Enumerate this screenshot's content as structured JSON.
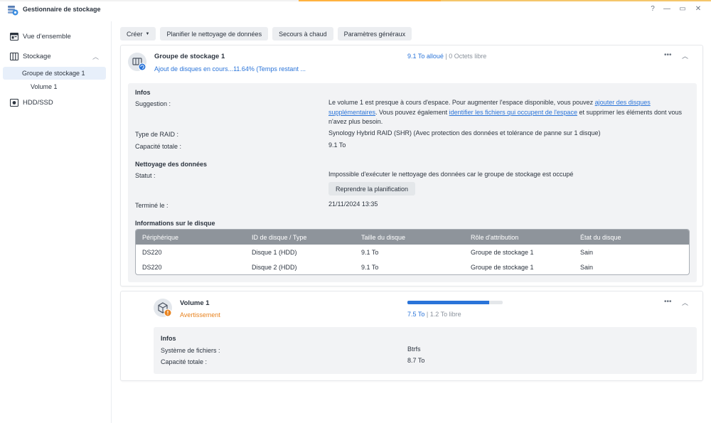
{
  "app": {
    "title": "Gestionnaire de stockage"
  },
  "window_controls": {
    "help": "?",
    "minimize": "—",
    "maximize": "▭",
    "close": "✕"
  },
  "sidebar": {
    "items": [
      {
        "label": "Vue d’ensemble",
        "icon": "overview-icon"
      },
      {
        "label": "Stockage",
        "icon": "storage-icon",
        "expanded": true
      },
      {
        "label": "Groupe de stockage 1",
        "selected": true
      },
      {
        "label": "Volume 1"
      },
      {
        "label": "HDD/SSD",
        "icon": "hdd-icon"
      }
    ]
  },
  "toolbar": {
    "create": "Créer",
    "schedule_scrub": "Planifier le nettoyage de données",
    "hot_spare": "Secours à chaud",
    "global_settings": "Paramètres généraux"
  },
  "pool": {
    "name": "Groupe de stockage 1",
    "status": "Ajout de disques en cours...11.64% (Temps restant ...",
    "allocated": "9.1 To alloué",
    "separator": "|",
    "free": "0 Octets libre",
    "info_title": "Infos",
    "suggestion_label": "Suggestion :",
    "suggestion_text_1": "Le volume 1 est presque à cours d'espace. Pour augmenter l'espace disponible, vous pouvez ",
    "suggestion_link_1": "ajouter des disques supplémentaires",
    "suggestion_text_2": ". Vous pouvez également ",
    "suggestion_link_2": "identifier les fichiers qui occupent de l'espace",
    "suggestion_text_3": " et supprimer les éléments dont vous n'avez plus besoin.",
    "raid_label": "Type de RAID :",
    "raid_value": "Synology Hybrid RAID (SHR) (Avec protection des données et tolérance de panne sur 1 disque)",
    "capacity_label": "Capacité totale :",
    "capacity_value": "9.1 To",
    "scrub_title": "Nettoyage des données",
    "status_label": "Statut :",
    "status_value": "Impossible d'exécuter le nettoyage des données car le groupe de stockage est occupé",
    "resume_button": "Reprendre la planification",
    "finished_label": "Terminé le :",
    "finished_value": "21/11/2024 13:35",
    "disk_info_title": "Informations sur le disque",
    "table": {
      "headers": [
        "Périphérique",
        "ID de disque / Type",
        "Taille du disque",
        "Rôle d'attribution",
        "État du disque"
      ],
      "rows": [
        [
          "DS220",
          "Disque 1 (HDD)",
          "9.1 To",
          "Groupe de stockage 1",
          "Sain"
        ],
        [
          "DS220",
          "Disque 2 (HDD)",
          "9.1 To",
          "Groupe de stockage 1",
          "Sain"
        ]
      ]
    }
  },
  "volume": {
    "name": "Volume 1",
    "status": "Avertissement",
    "used": "7.5 To",
    "separator": "|",
    "free": "1.2 To libre",
    "usage_fraction": 0.86,
    "info_title": "Infos",
    "fs_label": "Système de fichiers :",
    "fs_value": "Btrfs",
    "capacity_label": "Capacité totale :",
    "capacity_value": "8.7 To"
  },
  "colors": {
    "accent": "#2a74d9",
    "warning": "#e8831f",
    "healthy": "#2c9c2c",
    "selected_nav": "#e7effa"
  }
}
